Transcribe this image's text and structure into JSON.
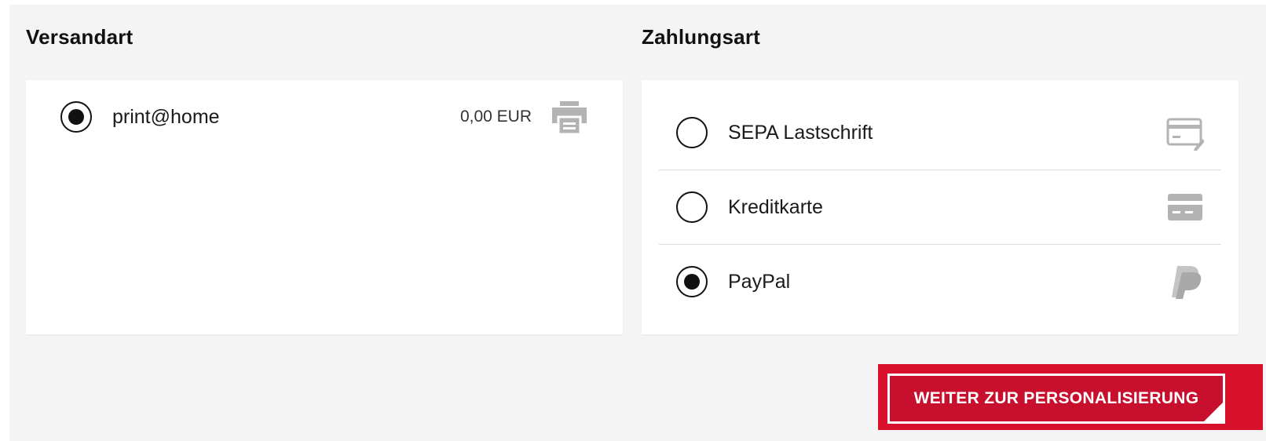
{
  "shipping": {
    "title": "Versandart",
    "options": [
      {
        "label": "print@home",
        "price": "0,00 EUR",
        "selected": true,
        "icon": "printer-icon"
      }
    ]
  },
  "payment": {
    "title": "Zahlungsart",
    "options": [
      {
        "label": "SEPA Lastschrift",
        "selected": false,
        "icon": "sepa-card-icon"
      },
      {
        "label": "Kreditkarte",
        "selected": false,
        "icon": "credit-card-icon"
      },
      {
        "label": "PayPal",
        "selected": true,
        "icon": "paypal-icon"
      }
    ]
  },
  "cta": {
    "label": "WEITER ZUR PERSONALISIERUNG"
  },
  "colors": {
    "accent": "#c8102e",
    "panel_bg": "#f4f4f4",
    "icon_gray": "#b3b3b3"
  }
}
